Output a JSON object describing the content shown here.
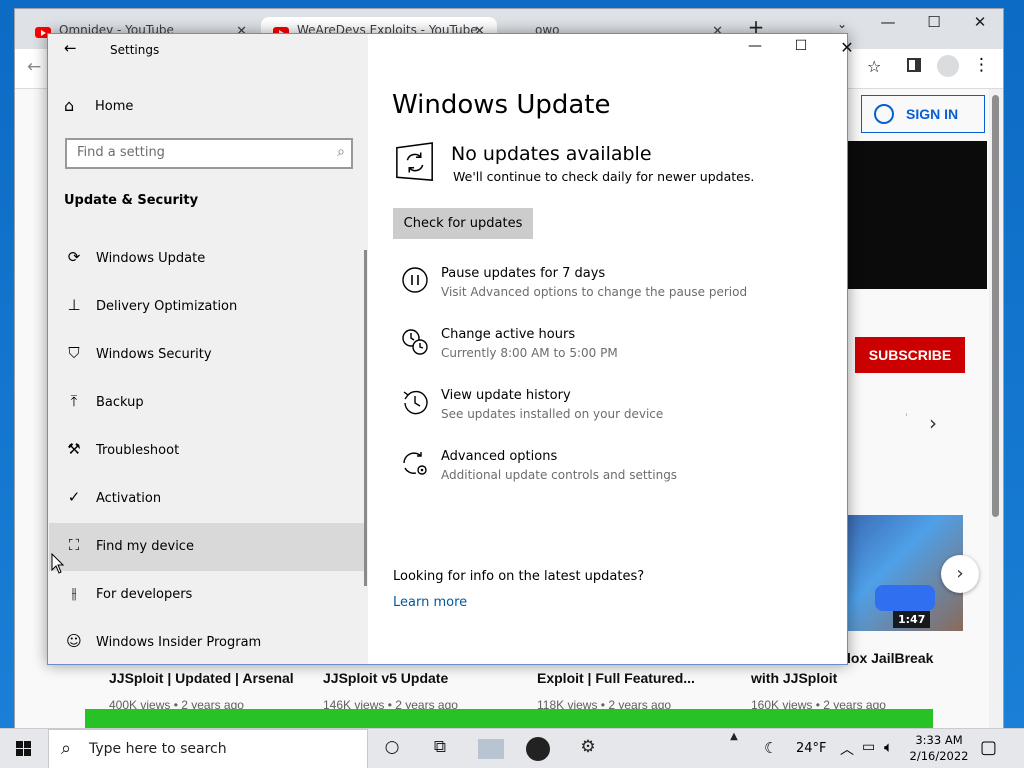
{
  "browser": {
    "tabs": [
      {
        "label": "Omnidev - YouTube"
      },
      {
        "label": "WeAreDevs Exploits - YouTube"
      },
      {
        "label": "owo"
      }
    ],
    "new_tab": "+",
    "minimize": "—",
    "maximize": "☐",
    "close": "✕"
  },
  "youtube": {
    "signin_label": "SIGN IN",
    "subscribe_label": "SUBSCRIBE",
    "thumb_duration": "1:47",
    "next_glyph": "›",
    "carousel_next": "›",
    "videos": [
      {
        "title": "JJSploit | Updated | Arsenal",
        "meta": "400K views • 2 years ago"
      },
      {
        "title": "JJSploit v5 Update",
        "meta": "146K views • 2 years ago"
      },
      {
        "title": "Exploit | Full Featured...",
        "meta": "118K views • 2 years ago"
      },
      {
        "title": "with JJSploit",
        "meta": "160K views • 2 years ago"
      }
    ],
    "side_title": "lox JailBreak"
  },
  "settings": {
    "window_title": "Settings",
    "home_label": "Home",
    "search_placeholder": "Find a setting",
    "section_heading": "Update & Security",
    "nav_items": [
      {
        "label": "Windows Update",
        "icon": "sync-icon"
      },
      {
        "label": "Delivery Optimization",
        "icon": "delivery-icon"
      },
      {
        "label": "Windows Security",
        "icon": "shield-icon"
      },
      {
        "label": "Backup",
        "icon": "backup-icon"
      },
      {
        "label": "Troubleshoot",
        "icon": "wrench-icon"
      },
      {
        "label": "Activation",
        "icon": "check-circle-icon"
      },
      {
        "label": "Find my device",
        "icon": "person-pin-icon"
      },
      {
        "label": "For developers",
        "icon": "dev-icon"
      },
      {
        "label": "Windows Insider Program",
        "icon": "insider-cat-icon"
      }
    ],
    "hovered_item": "Find my device",
    "page_title": "Windows Update",
    "status_title": "No updates available",
    "status_sub": "We'll continue to check daily for newer updates.",
    "check_button": "Check for updates",
    "options": [
      {
        "title": "Pause updates for 7 days",
        "sub": "Visit Advanced options to change the pause period",
        "icon": "pause-icon"
      },
      {
        "title": "Change active hours",
        "sub": "Currently 8:00 AM to 5:00 PM",
        "icon": "active-hours-icon"
      },
      {
        "title": "View update history",
        "sub": "See updates installed on your device",
        "icon": "history-icon"
      },
      {
        "title": "Advanced options",
        "sub": "Additional update controls and settings",
        "icon": "advanced-gear-icon"
      }
    ],
    "info_question": "Looking for info on the latest updates?",
    "learn_more": "Learn more"
  },
  "taskbar": {
    "search_placeholder": "Type here to search",
    "temperature": "24°F",
    "time": "3:33 AM",
    "date": "2/16/2022"
  },
  "colors": {
    "accent_link": "#005a9e",
    "youtube_red": "#cc0000",
    "youtube_blue": "#065fd4"
  }
}
